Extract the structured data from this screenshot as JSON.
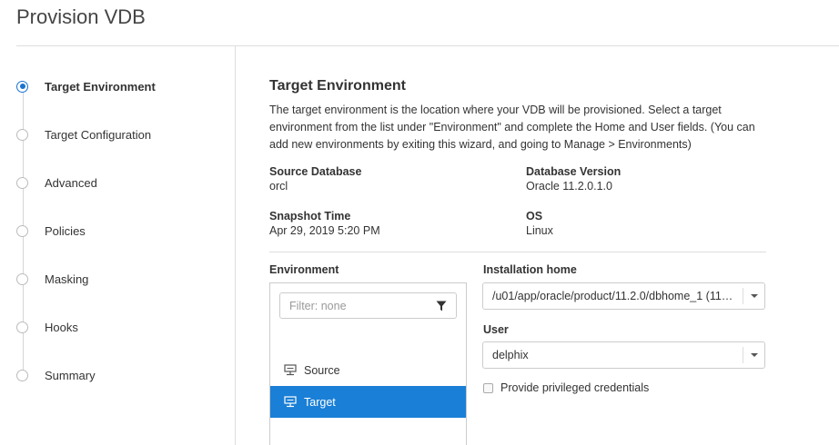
{
  "page": {
    "title": "Provision VDB"
  },
  "steps": [
    {
      "label": "Target Environment",
      "active": true
    },
    {
      "label": "Target Configuration",
      "active": false
    },
    {
      "label": "Advanced",
      "active": false
    },
    {
      "label": "Policies",
      "active": false
    },
    {
      "label": "Masking",
      "active": false
    },
    {
      "label": "Hooks",
      "active": false
    },
    {
      "label": "Summary",
      "active": false
    }
  ],
  "section": {
    "title": "Target Environment",
    "description": "The target environment is the location where your VDB will be provisioned. Select a target environment from the list under \"Environment\" and complete the Home and User fields. (You can add new environments by exiting this wizard, and going to Manage > Environments)"
  },
  "info": {
    "source_database": {
      "label": "Source Database",
      "value": "orcl"
    },
    "database_version": {
      "label": "Database Version",
      "value": "Oracle 11.2.0.1.0"
    },
    "snapshot_time": {
      "label": "Snapshot Time",
      "value": "Apr 29, 2019 5:20 PM"
    },
    "os": {
      "label": "OS",
      "value": "Linux"
    }
  },
  "environment": {
    "label": "Environment",
    "filter_placeholder": "Filter: none",
    "items": [
      {
        "label": "Source",
        "selected": false,
        "icon": "server-icon"
      },
      {
        "label": "Target",
        "selected": true,
        "icon": "server-icon"
      }
    ]
  },
  "installation_home": {
    "label": "Installation home",
    "value": "/u01/app/oracle/product/11.2.0/dbhome_1 (11…"
  },
  "user": {
    "label": "User",
    "value": "delphix"
  },
  "privileged": {
    "label": "Provide privileged credentials",
    "checked": false
  },
  "colors": {
    "accent": "#1a7fd6",
    "divider": "#dddddd"
  }
}
